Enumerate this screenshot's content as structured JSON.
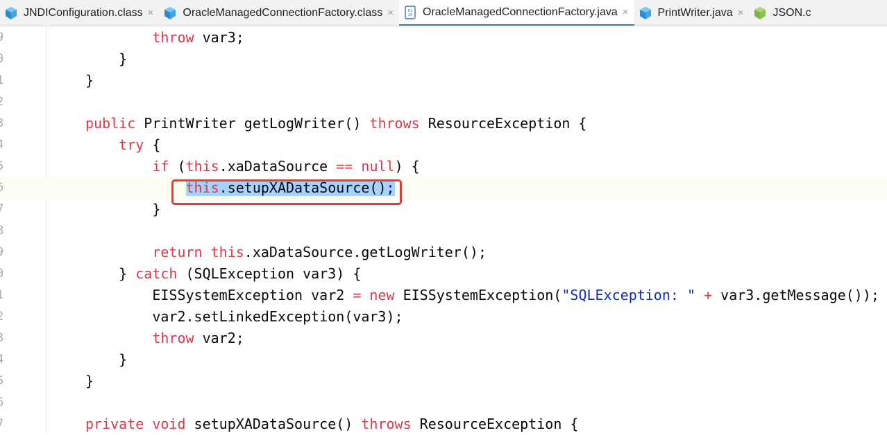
{
  "tabs": [
    {
      "label": "JNDIConfiguration.class",
      "icon": "class-icon",
      "active": false
    },
    {
      "label": "OracleManagedConnectionFactory.class",
      "icon": "class-icon",
      "active": false
    },
    {
      "label": "OracleManagedConnectionFactory.java",
      "icon": "java-source-icon",
      "active": true
    },
    {
      "label": "PrintWriter.java",
      "icon": "class-icon",
      "active": false
    },
    {
      "label": "JSON.c",
      "icon": "json-class-icon",
      "active": false
    }
  ],
  "close_glyph": "×",
  "lines": [
    {
      "n": "9",
      "tokens": [
        [
          "",
          "        "
        ],
        [
          "kw",
          "throw"
        ],
        [
          "",
          " var3;"
        ]
      ]
    },
    {
      "n": "0",
      "tokens": [
        [
          "",
          "    }"
        ]
      ]
    },
    {
      "n": "1",
      "tokens": [
        [
          "",
          "}"
        ]
      ]
    },
    {
      "n": "2",
      "tokens": []
    },
    {
      "n": "3",
      "tokens": [
        [
          "kw",
          "public"
        ],
        [
          "",
          " PrintWriter getLogWriter() "
        ],
        [
          "kw",
          "throws"
        ],
        [
          "",
          " ResourceException {"
        ]
      ]
    },
    {
      "n": "4",
      "tokens": [
        [
          "",
          "    "
        ],
        [
          "kw",
          "try"
        ],
        [
          "",
          " {"
        ]
      ]
    },
    {
      "n": "5",
      "tokens": [
        [
          "",
          "        "
        ],
        [
          "kw",
          "if"
        ],
        [
          "",
          " ("
        ],
        [
          "kw",
          "this"
        ],
        [
          "",
          ".xaDataSource "
        ],
        [
          "kw",
          "=="
        ],
        [
          "",
          " "
        ],
        [
          "kw",
          "null"
        ],
        [
          "",
          ") {"
        ]
      ]
    },
    {
      "n": "6",
      "current": true,
      "tokens": [
        [
          "",
          "            "
        ],
        [
          "kw sel",
          "this"
        ],
        [
          "sel",
          ".setupXADataSource();"
        ]
      ]
    },
    {
      "n": "7",
      "tokens": [
        [
          "",
          "        }"
        ]
      ]
    },
    {
      "n": "8",
      "tokens": []
    },
    {
      "n": "9",
      "tokens": [
        [
          "",
          "        "
        ],
        [
          "kw",
          "return"
        ],
        [
          "",
          " "
        ],
        [
          "kw",
          "this"
        ],
        [
          "",
          ".xaDataSource.getLogWriter();"
        ]
      ]
    },
    {
      "n": "0",
      "tokens": [
        [
          "",
          "    } "
        ],
        [
          "kw",
          "catch"
        ],
        [
          "",
          " (SQLException var3) {"
        ]
      ]
    },
    {
      "n": "1",
      "tokens": [
        [
          "",
          "        EISSystemException var2 "
        ],
        [
          "kw",
          "="
        ],
        [
          "",
          " "
        ],
        [
          "kw",
          "new"
        ],
        [
          "",
          " EISSystemException("
        ],
        [
          "str",
          "\"SQLException: \""
        ],
        [
          "",
          " "
        ],
        [
          "kw",
          "+"
        ],
        [
          "",
          " var3.getMessage());"
        ]
      ]
    },
    {
      "n": "2",
      "tokens": [
        [
          "",
          "        var2.setLinkedException(var3);"
        ]
      ]
    },
    {
      "n": "3",
      "tokens": [
        [
          "",
          "        "
        ],
        [
          "kw",
          "throw"
        ],
        [
          "",
          " var2;"
        ]
      ]
    },
    {
      "n": "4",
      "tokens": [
        [
          "",
          "    }"
        ]
      ]
    },
    {
      "n": "5",
      "tokens": [
        [
          "",
          "}"
        ]
      ]
    },
    {
      "n": "6",
      "tokens": []
    },
    {
      "n": "7",
      "tokens": [
        [
          "kw",
          "private"
        ],
        [
          "",
          " "
        ],
        [
          "kw",
          "void"
        ],
        [
          "",
          " setupXADataSource() "
        ],
        [
          "kw",
          "throws"
        ],
        [
          "",
          " ResourceException {"
        ]
      ]
    }
  ],
  "colors": {
    "keyword": "#d73a4a",
    "string": "#0f2ea8",
    "selection": "#a6d2ff",
    "annotation_box": "#e53935",
    "active_tab_underline": "#4083c9"
  }
}
